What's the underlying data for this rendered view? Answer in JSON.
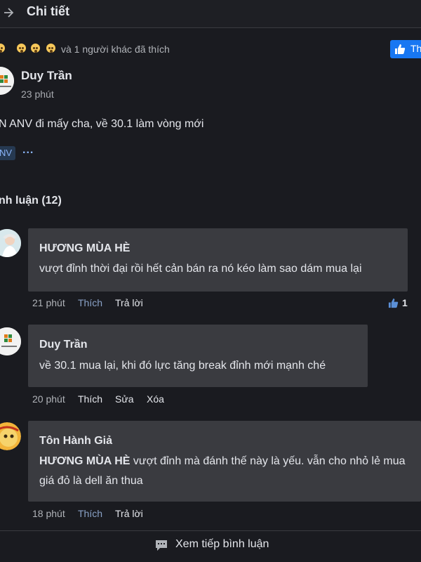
{
  "header": {
    "title": "Chi tiết"
  },
  "reactions": {
    "summary": "và 1 người khác đã thích"
  },
  "page_like_button": {
    "label": "Th"
  },
  "post": {
    "author": "Duy Trần",
    "time": "23 phút",
    "text": "N ANV đi mấy cha, về 30.1 làm vòng mới",
    "tag": "NV",
    "more": "..."
  },
  "comments_heading": "nh luận (12)",
  "comments": [
    {
      "author": "HƯƠNG MÙA HÈ",
      "text": "vượt đỉnh thời đại rồi hết cản bán ra nó kéo làm sao dám mua lại",
      "time": "21 phút",
      "actions": [
        "Thích",
        "Trả lời"
      ],
      "likes": "1"
    },
    {
      "author": "Duy Trần",
      "text": "về 30.1 mua lại, khi đó lực tăng break đỉnh mới mạnh ché",
      "time": "20 phút",
      "actions": [
        "Thích",
        "Sửa",
        "Xóa"
      ]
    },
    {
      "author": "Tôn Hành Giả",
      "mention": "HƯƠNG MÙA HÈ",
      "text": " vượt đỉnh mà đánh thế này là yếu. vẫn cho nhỏ lẻ mua giá đỏ là dell ăn thua",
      "time": "18 phút",
      "actions": [
        "Thích",
        "Trả lời"
      ]
    }
  ],
  "footer": {
    "load_more": "Xem tiếp bình luận"
  },
  "colors": {
    "background": "#1a1b20",
    "bubble": "#3a3b40",
    "accent": "#1877f2",
    "liked_action": "#8aa2c7"
  }
}
